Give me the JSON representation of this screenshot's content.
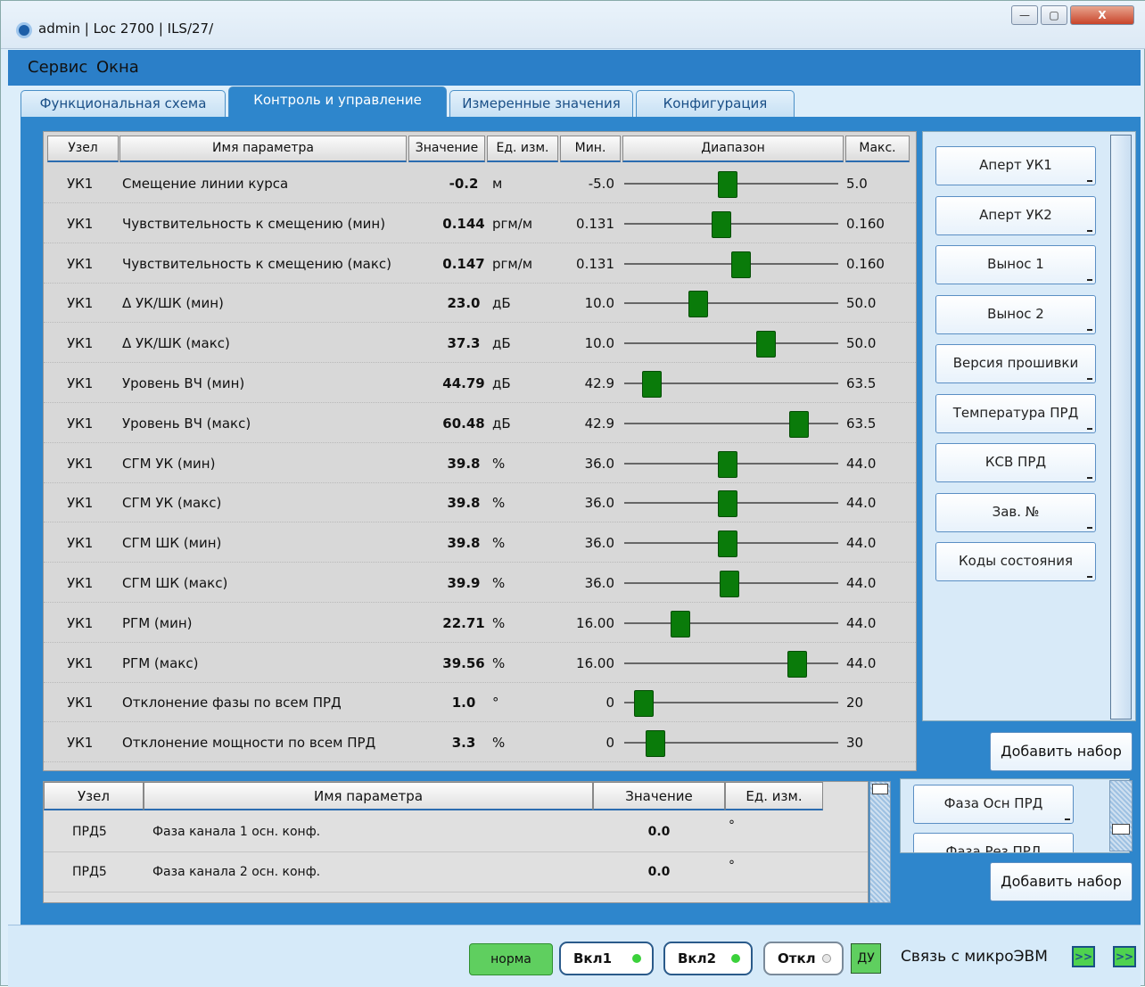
{
  "window": {
    "title": "admin | Loc 2700 | ILS/27/",
    "min": "—",
    "max": "▢",
    "close": "X"
  },
  "menu": [
    "Сервис",
    "Окна"
  ],
  "tabs": [
    "Функциональная схема",
    "Контроль и управление",
    "Измеренные значения",
    "Конфигурация"
  ],
  "table": {
    "headers": [
      "Узел",
      "Имя параметра",
      "Значение",
      "Ед. изм.",
      "Мин.",
      "Диапазон",
      "Макс."
    ],
    "rows": [
      {
        "node": "УК1",
        "name": "Смещение линии курса",
        "value": "-0.2",
        "unit": "м",
        "min": "-5.0",
        "max": "5.0",
        "level": 0.48
      },
      {
        "node": "УК1",
        "name": "Чувствительность к смещению (мин)",
        "value": "0.144",
        "unit": "ргм/м",
        "min": "0.131",
        "max": "0.160",
        "level": 0.45
      },
      {
        "node": "УК1",
        "name": "Чувствительность к смещению (макс)",
        "value": "0.147",
        "unit": "ргм/м",
        "min": "0.131",
        "max": "0.160",
        "level": 0.55
      },
      {
        "node": "УК1",
        "name": "Δ УК/ШК (мин)",
        "value": "23.0",
        "unit": "дБ",
        "min": "10.0",
        "max": "50.0",
        "level": 0.33
      },
      {
        "node": "УК1",
        "name": "Δ УК/ШК (макс)",
        "value": "37.3",
        "unit": "дБ",
        "min": "10.0",
        "max": "50.0",
        "level": 0.68
      },
      {
        "node": "УК1",
        "name": "Уровень ВЧ (мин)",
        "value": "44.79",
        "unit": "дБ",
        "min": "42.9",
        "max": "63.5",
        "level": 0.09
      },
      {
        "node": "УК1",
        "name": "Уровень ВЧ (макс)",
        "value": "60.48",
        "unit": "дБ",
        "min": "42.9",
        "max": "63.5",
        "level": 0.85
      },
      {
        "node": "УК1",
        "name": "СГМ УК (мин)",
        "value": "39.8",
        "unit": "%",
        "min": "36.0",
        "max": "44.0",
        "level": 0.48
      },
      {
        "node": "УК1",
        "name": "СГМ УК (макс)",
        "value": "39.8",
        "unit": "%",
        "min": "36.0",
        "max": "44.0",
        "level": 0.48
      },
      {
        "node": "УК1",
        "name": "СГМ ШК (мин)",
        "value": "39.8",
        "unit": "%",
        "min": "36.0",
        "max": "44.0",
        "level": 0.48
      },
      {
        "node": "УК1",
        "name": "СГМ ШК (макс)",
        "value": "39.9",
        "unit": "%",
        "min": "36.0",
        "max": "44.0",
        "level": 0.49
      },
      {
        "node": "УК1",
        "name": "РГМ (мин)",
        "value": "22.71",
        "unit": "%",
        "min": "16.00",
        "max": "44.0",
        "level": 0.24
      },
      {
        "node": "УК1",
        "name": "РГМ (макс)",
        "value": "39.56",
        "unit": "%",
        "min": "16.00",
        "max": "44.0",
        "level": 0.84
      },
      {
        "node": "УК1",
        "name": "Отклонение фазы по всем ПРД",
        "value": "1.0",
        "unit": "°",
        "min": "0",
        "max": "20",
        "level": 0.05
      },
      {
        "node": "УК1",
        "name": "Отклонение мощности по всем ПРД",
        "value": "3.3",
        "unit": "%",
        "min": "0",
        "max": "30",
        "level": 0.11
      }
    ]
  },
  "side_buttons": [
    "Аперт УК1",
    "Аперт УК2",
    "Вынос 1",
    "Вынос 2",
    "Версия прошивки",
    "Температура ПРД",
    "КСВ ПРД",
    "Зав. №",
    "Коды состояния"
  ],
  "add_set_label": "Добавить набор",
  "lower_table": {
    "headers": [
      "Узел",
      "Имя параметра",
      "Значение",
      "Ед. изм."
    ],
    "rows": [
      {
        "node": "ПРД5",
        "name": "Фаза канала 1 осн. конф.",
        "value": "0.0",
        "unit": "°"
      },
      {
        "node": "ПРД5",
        "name": "Фаза канала 2 осн. конф.",
        "value": "0.0",
        "unit": "°"
      }
    ]
  },
  "lower_buttons": [
    "Фаза Осн ПРД",
    "Фаза Рез ПРД"
  ],
  "status": {
    "norma": "норма",
    "on1": "Вкл1",
    "on2": "Вкл2",
    "off": "Откл",
    "du": "ДУ",
    "conn": "Связь с микроЭВМ",
    "arrow": ">>"
  },
  "colors": {
    "accent": "#2e86cc",
    "thumb": "#0a7b0a",
    "led_on": "#3bd13b"
  }
}
